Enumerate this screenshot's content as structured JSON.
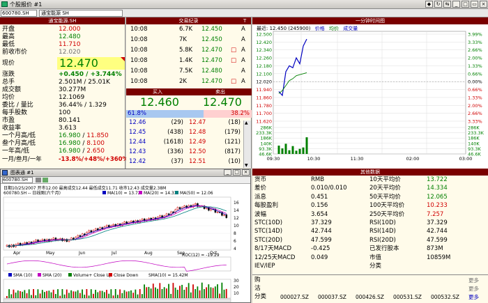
{
  "window": {
    "title": "个股报价 #1"
  },
  "toolbar": {
    "code": "600780.SH",
    "name": "通宝能源 SH"
  },
  "quote": {
    "header": "通宝能源.SH",
    "price": "12.470",
    "rows": [
      {
        "label": "开盘",
        "value": "12.000"
      },
      {
        "label": "最高",
        "value": "12.480"
      },
      {
        "label": "最低",
        "value": "11.710"
      },
      {
        "label": "前收市价",
        "value": "12.020"
      }
    ],
    "current_label": "现价",
    "change_label": "涨跌",
    "change": "+0.450 / +3.744%",
    "rows2": [
      {
        "label": "总手",
        "value": "2.501M / 25.01K"
      },
      {
        "label": "成交额",
        "value": "30.277M"
      },
      {
        "label": "均价",
        "value": "12.1069"
      },
      {
        "label": "委比 / 量比",
        "value": "36.44% / 1.329"
      },
      {
        "label": "每手股数",
        "value": "100"
      },
      {
        "label": "市盈",
        "value": "80.141"
      },
      {
        "label": "收益率",
        "value": "3.613"
      }
    ],
    "ranges": [
      {
        "label": "一个月高/低",
        "high": "16.980",
        "low": "11.850"
      },
      {
        "label": "叁个月高/低",
        "high": "16.980",
        "low": "8.100"
      },
      {
        "label": "一年高/低",
        "high": "16.980",
        "low": "2.650"
      }
    ],
    "perf_label": "一月/叁月/一年",
    "perf": "-13.8%/+48%/+360%"
  },
  "ticks": {
    "header": "交易纪录",
    "col_t": "T",
    "rows": [
      {
        "time": "10:08",
        "vol": "6.7K",
        "price": "12.450",
        "flag": "A",
        "mark": ""
      },
      {
        "time": "10:08",
        "vol": "7K",
        "price": "12.450",
        "flag": "A",
        "mark": ""
      },
      {
        "time": "10:08",
        "vol": "5.8K",
        "price": "12.470",
        "flag": "A",
        "mark": "□"
      },
      {
        "time": "10:08",
        "vol": "1.4K",
        "price": "12.470",
        "flag": "A",
        "mark": "□"
      },
      {
        "time": "10:08",
        "vol": "7.5K",
        "price": "12.480",
        "flag": "A",
        "mark": ""
      },
      {
        "time": "10:08",
        "vol": "2K",
        "price": "12.470",
        "flag": "A",
        "mark": "□"
      }
    ]
  },
  "book": {
    "bid_label": "买入",
    "ask_label": "卖出",
    "bid": "12.460",
    "ask": "12.470",
    "bid_pct": "61.8%",
    "ask_pct": "38.2%",
    "bid_ratio": 0.618,
    "rows": [
      {
        "bp": "12.46",
        "bq": "29)",
        "ap": "12.47",
        "aq": "18)"
      },
      {
        "bp": "12.45",
        "bq": "438)",
        "ap": "12.48",
        "aq": "179)"
      },
      {
        "bp": "12.44",
        "bq": "1618)",
        "ap": "12.49",
        "aq": "121)"
      },
      {
        "bp": "12.43",
        "bq": "336)",
        "ap": "12.50",
        "aq": "817)"
      },
      {
        "bp": "12.42",
        "bq": "37)",
        "ap": "12.51",
        "aq": "10)"
      }
    ]
  },
  "intraday": {
    "header": "一分钟时间图",
    "legend": {
      "last": "最近: 12.450 (245900)",
      "price": "价格",
      "avg": "均价",
      "vol": "成交量"
    },
    "left_ticks": [
      "12.500",
      "12.420",
      "12.340",
      "12.260",
      "12.180",
      "12.100",
      "12.020",
      "11.940",
      "11.860",
      "11.780",
      "11.700",
      "11.620",
      "286K",
      "233.3K",
      "186K",
      "140K",
      "93.3K",
      "46.6K"
    ],
    "right_ticks": [
      "3.99%",
      "3.33%",
      "2.66%",
      "2.00%",
      "1.33%",
      "0.66%",
      "0.00%",
      "0.66%",
      "1.33%",
      "2.00%",
      "2.66%",
      "3.33%",
      "286K",
      "233.3K",
      "186K",
      "140K",
      "93.3K",
      "46.6K"
    ],
    "time_ticks": [
      "09:30",
      "10:30",
      "11:30",
      "02:00",
      "03:00"
    ],
    "chart_data": {
      "type": "line",
      "x": [
        "09:30",
        "09:35",
        "09:40",
        "09:45",
        "09:50",
        "09:55",
        "10:00",
        "10:05",
        "10:08"
      ],
      "series": [
        {
          "name": "价格",
          "values": [
            11.92,
            11.88,
            12.12,
            12.18,
            12.16,
            12.26,
            12.2,
            12.38,
            12.45
          ]
        },
        {
          "name": "均价",
          "values": [
            11.9,
            11.93,
            11.98,
            12.03,
            12.05,
            12.08,
            12.09,
            12.1,
            12.11
          ]
        }
      ],
      "volume": [
        90,
        60,
        110,
        40,
        85,
        35,
        55,
        70,
        180
      ],
      "ylim": [
        11.62,
        12.5
      ],
      "prev_close": 12.02
    }
  },
  "other": {
    "header": "其他数据",
    "rows": [
      {
        "k1": "货币",
        "v1": "RMB",
        "k2": "10天平均价",
        "v2": "13.722"
      },
      {
        "k1": "差价",
        "v1": "0.010/0.010",
        "k2": "20天平均价",
        "v2": "14.334"
      },
      {
        "k1": "派息",
        "v1": "0.451",
        "k2": "50天平均价",
        "v2": "12.065"
      },
      {
        "k1": "每股盈利",
        "v1": "0.156",
        "k2": "100天平均价",
        "v2": "10.233"
      },
      {
        "k1": "波幅",
        "v1": "3.654",
        "k2": "250天平均价",
        "v2": "7.257"
      },
      {
        "k1": "STC(10D)",
        "v1": "37.329",
        "k2": "RSI(10D)",
        "v2": "37.329"
      },
      {
        "k1": "STC(14D)",
        "v1": "42.744",
        "k2": "RSI(14D)",
        "v2": "42.744"
      },
      {
        "k1": "STC(20D)",
        "v1": "47.599",
        "k2": "RSI(20D)",
        "v2": "47.599"
      },
      {
        "k1": "8/17天MACD",
        "v1": "-0.425",
        "k2": "已发行股本",
        "v2": "873M"
      },
      {
        "k1": "12/25天MACD",
        "v1": "0.049",
        "k2": "市值",
        "v2": "10859M"
      },
      {
        "k1": "IEV/IEP",
        "v1": "",
        "k2": "分类",
        "v2": ""
      }
    ],
    "buy_label": "购",
    "sell_label": "沽",
    "cat_label": "分类",
    "more": "更多",
    "cats": [
      "000027.SZ",
      "000037.SZ",
      "000426.SZ",
      "000531.SZ",
      "000532.SZ"
    ]
  },
  "daily": {
    "title": "图表通 #1",
    "code": "600780.SH",
    "info": "日期10/25/2007 开市12.00 最高成交12.44 最低成交11.71 收市12.43 成交量2.38M",
    "info2": "600780.SH -- 日线图(六个月)",
    "ma_labels": [
      "MA(10) = 13.72",
      "MA(20) = 14.33",
      "MA(50) = 12.06"
    ],
    "months": [
      "Apr",
      "May",
      "Jun",
      "Jul",
      "Aug",
      "Sep",
      "Oct"
    ],
    "price_ticks": [
      "16",
      "14",
      "12",
      "10",
      "8",
      "6",
      "4"
    ],
    "roc_label": "ROC(12) = -19.29",
    "vol_legend": [
      "SMA (10)",
      "SMA (20)",
      "Volume+ Close Up",
      "Close Down"
    ],
    "vol_label": "SMA(10) = 15.42M",
    "vol_ticks": [
      "30",
      "20",
      "10"
    ],
    "chart_data": {
      "type": "candlestick",
      "x": [
        "Apr",
        "May",
        "Jun",
        "Jul",
        "Aug",
        "Sep",
        "Oct"
      ],
      "close": [
        4.6,
        5.2,
        6.0,
        6.4,
        6.2,
        8.0,
        9.4,
        10.2,
        11.0,
        11.6,
        12.4,
        14.6,
        15.4,
        14.2,
        12.43
      ],
      "ylim": [
        4,
        16
      ]
    }
  }
}
